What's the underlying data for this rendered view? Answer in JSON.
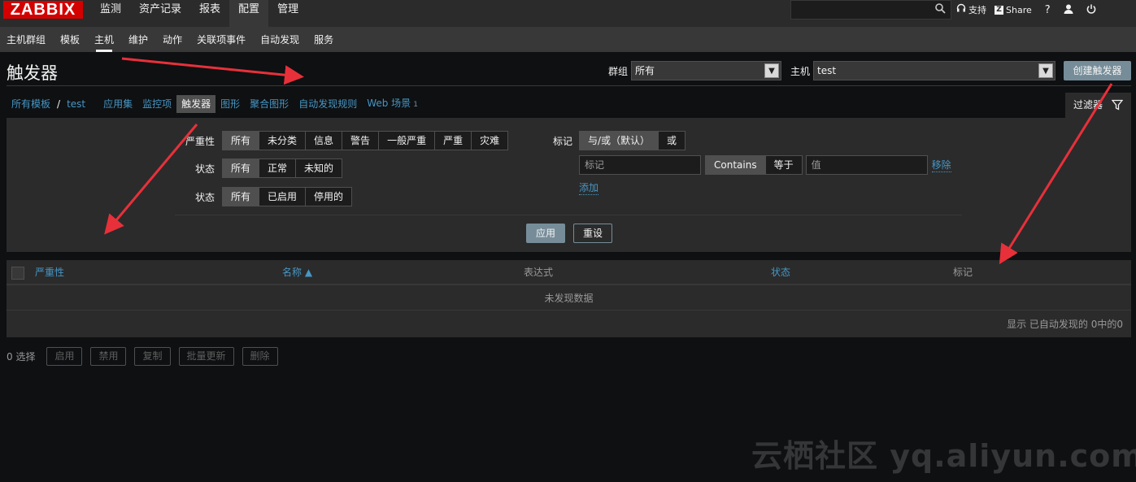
{
  "brand": {
    "logo_text": "ZABBIX",
    "accent": "#d40000",
    "link_color": "#4796c4",
    "primary_button": "#768d99"
  },
  "main_menu": [
    {
      "label": "监测"
    },
    {
      "label": "资产记录"
    },
    {
      "label": "报表"
    },
    {
      "label": "配置",
      "active": true
    },
    {
      "label": "管理"
    }
  ],
  "top_links": {
    "support": "支持",
    "share": "Share",
    "help": "?",
    "search_icon": "search-icon",
    "support_icon": "headset-icon",
    "profile_icon": "user-icon",
    "logout_icon": "power-icon"
  },
  "sub_menu": [
    {
      "label": "主机群组"
    },
    {
      "label": "模板"
    },
    {
      "label": "主机",
      "active": true
    },
    {
      "label": "维护"
    },
    {
      "label": "动作"
    },
    {
      "label": "关联项事件"
    },
    {
      "label": "自动发现"
    },
    {
      "label": "服务"
    }
  ],
  "page": {
    "title": "触发器",
    "group_label": "群组",
    "group_value": "所有",
    "host_label": "主机",
    "host_value": "test",
    "create_button": "创建触发器"
  },
  "breadcrumb": {
    "all_templates": "所有模板",
    "separator": "/",
    "host": "test",
    "tabs": [
      {
        "label": "应用集"
      },
      {
        "label": "监控项"
      },
      {
        "label": "触发器",
        "selected": true
      },
      {
        "label": "图形"
      },
      {
        "label": "聚合图形"
      },
      {
        "label": "自动发现规则"
      },
      {
        "label": "Web 场景",
        "count": "1"
      }
    ]
  },
  "filter": {
    "tab_label": "过滤器",
    "severity_label": "严重性",
    "severity_options": [
      "所有",
      "未分类",
      "信息",
      "警告",
      "一般严重",
      "严重",
      "灾难"
    ],
    "severity_selected": "所有",
    "state_label": "状态",
    "state_options": [
      "所有",
      "正常",
      "未知的"
    ],
    "status_label": "状态",
    "status_options": [
      "所有",
      "已启用",
      "停用的"
    ],
    "tags_label": "标记",
    "tags_mode_options": [
      "与/或（默认）",
      "或"
    ],
    "tag_placeholder": "标记",
    "tag_operator_options": [
      "Contains",
      "等于"
    ],
    "value_placeholder": "值",
    "remove_link": "移除",
    "add_link": "添加",
    "apply_button": "应用",
    "reset_button": "重设"
  },
  "table": {
    "columns": [
      "严重性",
      "名称 ▲",
      "表达式",
      "状态",
      "标记"
    ],
    "empty_text": "未发现数据",
    "footer": "显示 已自动发现的 0中的0"
  },
  "actions": {
    "selected_count": "0 选择",
    "buttons": [
      "启用",
      "禁用",
      "复制",
      "批量更新",
      "删除"
    ]
  },
  "watermark": "云栖社区 yq.aliyun.com",
  "annotation_color": "#e8303a"
}
